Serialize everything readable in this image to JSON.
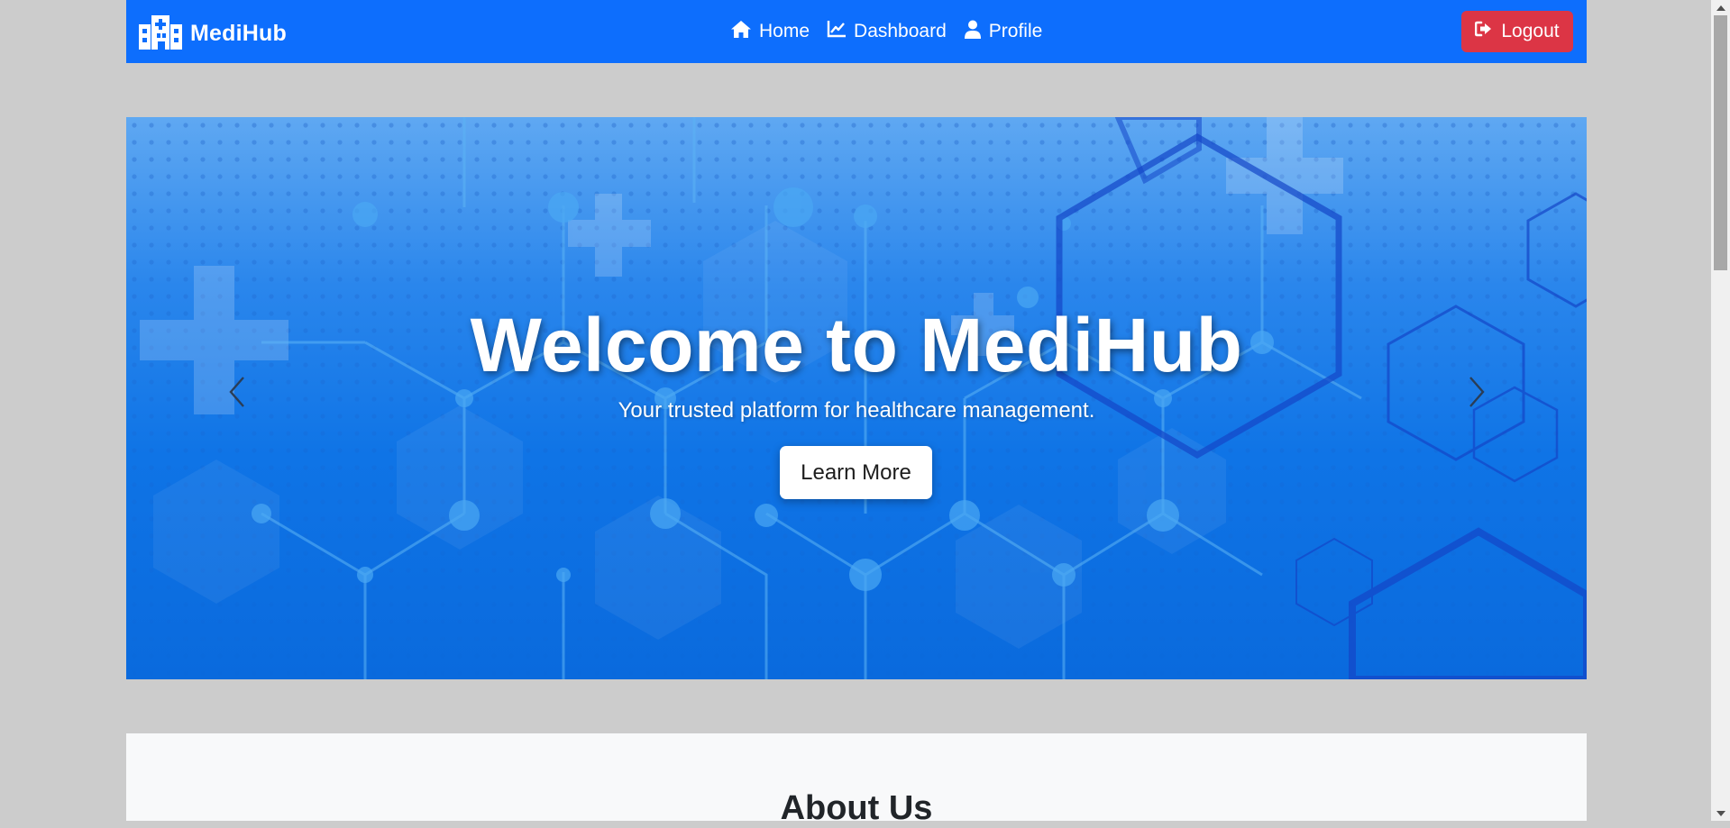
{
  "navbar": {
    "brand": "MediHub",
    "brand_icon": "hospital-icon",
    "links": [
      {
        "label": "Home",
        "icon": "home-icon"
      },
      {
        "label": "Dashboard",
        "icon": "chart-line-icon"
      },
      {
        "label": "Profile",
        "icon": "user-icon"
      }
    ],
    "logout_label": "Logout",
    "logout_icon": "sign-out-icon"
  },
  "hero": {
    "title": "Welcome to MediHub",
    "subtitle": "Your trusted platform for healthcare management.",
    "button_label": "Learn More"
  },
  "about": {
    "title": "About Us"
  },
  "colors": {
    "primary": "#0d6efd",
    "danger": "#dc3545",
    "page_bg": "#cccccc",
    "section_bg": "#f8f9fa"
  }
}
